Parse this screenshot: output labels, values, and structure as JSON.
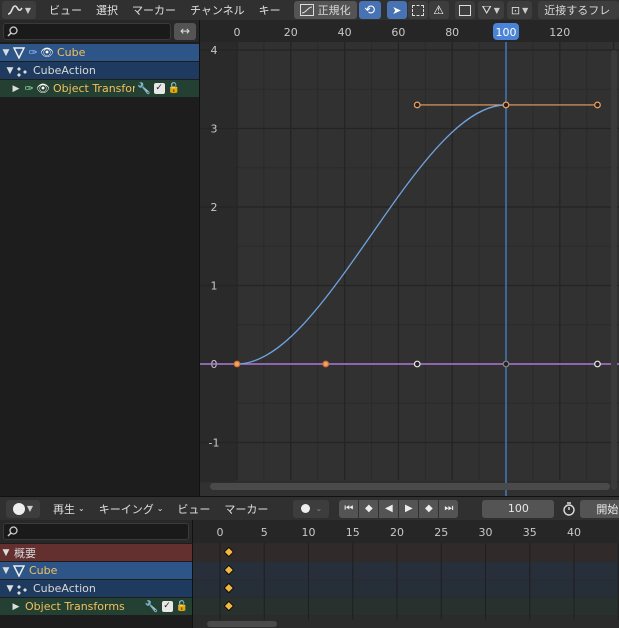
{
  "graph_header": {
    "menus": [
      "ビュー",
      "選択",
      "マーカー",
      "チャンネル",
      "キー"
    ],
    "normalize_label": "正規化",
    "snap_label": "近接するフレ"
  },
  "channels": {
    "items": [
      {
        "label": "Cube"
      },
      {
        "label": "CubeAction"
      },
      {
        "label": "Object Transfor"
      }
    ]
  },
  "graph": {
    "x_ticks": [
      "0",
      "20",
      "40",
      "60",
      "80",
      "100",
      "120"
    ],
    "y_ticks": [
      "4",
      "3",
      "2",
      "1",
      "0",
      "-1"
    ],
    "current_frame": "100",
    "colors": {
      "curve": "#6fa3df",
      "handle": "#f0a060",
      "playhead": "#4b84d6",
      "bg": "#313131"
    }
  },
  "timeline_header": {
    "menus": [
      "再生",
      "キーイング",
      "ビュー",
      "マーカー"
    ],
    "frame_value": "100",
    "start_label": "開始"
  },
  "dopesheet": {
    "x_ticks": [
      "0",
      "5",
      "10",
      "15",
      "20",
      "25",
      "30",
      "35",
      "40"
    ],
    "summary_label": "概要",
    "items": [
      {
        "label": "Cube"
      },
      {
        "label": "CubeAction"
      },
      {
        "label": "Object Transforms"
      }
    ]
  }
}
